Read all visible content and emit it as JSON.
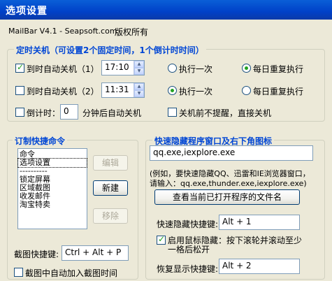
{
  "window": {
    "title": "选项设置",
    "app_name": "MailBar V4.1 - Seapsoft.com",
    "copyright": "版权所有"
  },
  "timed_shutdown": {
    "title": "定时关机（可设置2个固定时间，1个倒计时时间）",
    "rows": [
      {
        "label": "到时自动关机（1）",
        "checked": true,
        "time": "17:10",
        "once_label": "执行一次",
        "daily_label": "每日重复执行",
        "selected": "daily"
      },
      {
        "label": "到时自动关机（2）",
        "checked": false,
        "time": "11:31",
        "once_label": "执行一次",
        "daily_label": "每日重复执行",
        "selected": "once"
      }
    ],
    "countdown_label": "倒计时：",
    "countdown_value": "0",
    "countdown_suffix": "分钟后自动关机",
    "no_prompt_label": "关机前不提醒，直接关机"
  },
  "shortcuts": {
    "title": "订制快捷命令",
    "items": [
      "命令",
      "选项设置",
      "----------",
      "锁定屏幕",
      "区域截图",
      "收发邮件",
      "淘宝特卖"
    ],
    "selected_index": 1,
    "edit_label": "编辑",
    "new_label": "新建",
    "remove_label": "移除",
    "screenshot_hotkey_label": "截图快捷键:",
    "screenshot_hotkey_value": "Ctrl + Alt + P",
    "add_time_label": "截图中自动加入截图时间"
  },
  "hide_windows": {
    "title": "快速隐藏程序窗口及右下角图标",
    "programs_value": "qq.exe,iexplore.exe",
    "hint_line1": "(例如，要快速隐藏QQ、迅雷和IE浏览器窗口，",
    "hint_line2": "请输入：qq.exe,thunder.exe,iexplore.exe)",
    "view_button": "查看当前已打开程序的文件名",
    "hide_hotkey_label": "快速隐藏快捷键:",
    "hide_hotkey_value": "Alt + 1",
    "mouse_label_line1": "启用鼠标隐藏：按下滚轮并滚动至少",
    "mouse_label_line2": "一格后松开",
    "restore_hotkey_label": "恢复显示快捷键:",
    "restore_hotkey_value": "Alt + 2"
  }
}
